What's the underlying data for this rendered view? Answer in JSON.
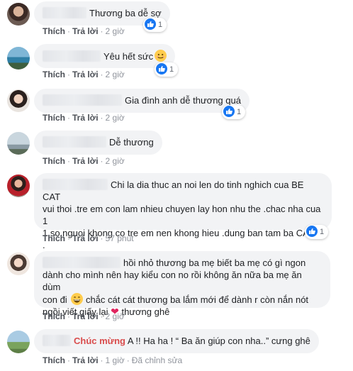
{
  "actions": {
    "like": "Thích",
    "reply": "Trả lời",
    "edited": "Đã chỉnh sửa"
  },
  "comments": [
    {
      "text": "Thương ba dễ sợ",
      "time": "2 giờ",
      "reactions": "1"
    },
    {
      "text": "Yêu hết sức",
      "time": "2 giờ",
      "reactions": "1"
    },
    {
      "text": "Gia đình anh dễ thương quá",
      "time": "2 giờ",
      "reactions": "1"
    },
    {
      "text": "Dễ thương",
      "time": "2 giờ"
    },
    {
      "line1": "Chi la dia thuc an noi len do tinh nghich cua BE CAT",
      "line2": "vui thoi .tre em con lam nhieu chuyen lay hon nhu the .chac nha cua 1",
      "line3": "1 so nguoi khong co tre em nen khong hieu .dung ban tam ba CAT a",
      "line4": ".",
      "time": "57 phút",
      "reactions": "1"
    },
    {
      "line1": "hồi nhỏ thương ba mẹ biết ba mẹ có gì ngon",
      "line2": "dành cho mình nên hay kiểu con no rồi không ăn nữa ba mẹ ăn dùm",
      "line3a": "con đi",
      "line3b": "chắc cát cát thương ba lắm mới để dành r còn nắn nót",
      "line4a": "ngồi viết giấy lại",
      "line4b": "thương ghê",
      "time": "2 giờ"
    },
    {
      "highlight": "Chúc mừng",
      "text": " A !! Ha ha ! “ Ba ăn giúp con nha..” cưng ghê",
      "time": "1 giờ"
    }
  ],
  "icons": {
    "reaction": "like-icon",
    "emoji_smile": "smiling-face-icon",
    "emoji_grin": "grinning-face-icon",
    "emoji_heart": "heart-icon"
  },
  "colors": {
    "like_blue": "#1877f2",
    "bubble_bg": "#f2f3f5",
    "highlight_red": "#d94c4c"
  }
}
